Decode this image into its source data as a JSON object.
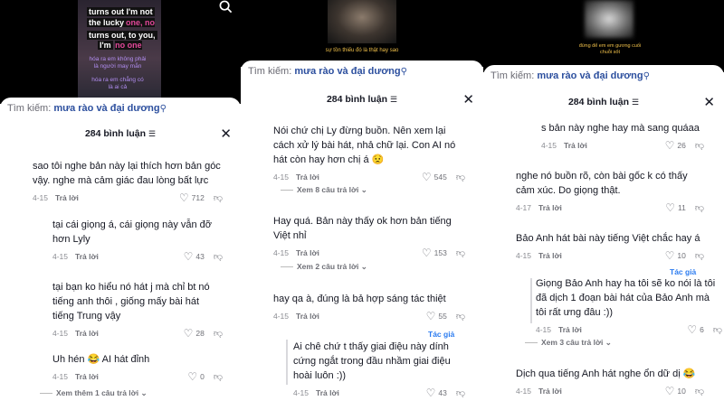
{
  "search": {
    "label": "Tìm kiếm:",
    "query": "mưa rào và đại dương",
    "icon": "search-icon"
  },
  "comments_title": "284 bình luận",
  "filter_icon": "filter-icon",
  "close_icon": "close-icon",
  "reply_label": "Trả lời",
  "panel1": {
    "video": {
      "line1": "turns out I'm not",
      "line2": "the lucky",
      "line2_hl": "one, no",
      "line3": "turns out, to you,",
      "line4": "I'm",
      "line4_hl": "no one",
      "sub1": "hóa ra em không phải",
      "sub2": "là người may mắn",
      "sub3": "hóa ra em chẳng có",
      "sub4": "là ai cả"
    },
    "comments": [
      {
        "text": "sao tôi nghe bản này lại thích hơn bản góc vậy. nghe mà cảm giác đau lòng bất lực",
        "date": "4-15",
        "likes": "712"
      },
      {
        "text": "tại cái giọng á, cái giọng này vẫn đỡ hơn Lyly",
        "date": "4-15",
        "likes": "43"
      },
      {
        "text": "tại bạn ko hiểu nó hát j mà chỉ bt nó tiếng anh thôi , giống mấy bài hát tiếng Trung vậy",
        "date": "4-15",
        "likes": "28"
      },
      {
        "text": "Uh hén 😂 AI hát đỉnh",
        "date": "4-15",
        "likes": "0"
      }
    ],
    "more": "Xem thêm 1 câu trả lời"
  },
  "panel2": {
    "video": {
      "sub": "sự tồn thiếu đó là thật hay sao"
    },
    "comments": [
      {
        "text": "Nói chứ chị Ly đừng buồn. Nên xem lại cách xử lý bài hát, nhả chữ lại. Con AI nó hát còn hay hơn chị á 😟",
        "date": "4-15",
        "likes": "545"
      },
      {
        "text": "Hay quá. Bản này thấy ok hơn bản tiếng Việt nhỉ",
        "date": "4-15",
        "likes": "153"
      },
      {
        "text": "hay qa à, đúng là bả hợp sáng tác thiệt",
        "date": "4-15",
        "likes": "55"
      },
      {
        "text": "Ai chê chứ t thấy giai điệu này dính cứng ngắt trong đầu nhầm giai điệu hoài luôn :))",
        "date": "4-15",
        "likes": "43"
      }
    ],
    "more1": "Xem 8 câu trả lời",
    "more2": "Xem 2 câu trả lời",
    "author": "Tác giả"
  },
  "panel3": {
    "video": {
      "sub1": "đừng để em em gương cuối",
      "sub2": "chuỗi sốt"
    },
    "comments": [
      {
        "text": "s bản này nghe hay mà sang quáaa",
        "date": "4-15",
        "likes": "26"
      },
      {
        "text": "nghe nó buồn rõ, còn bài gốc k có thấy cảm xúc. Do giọng thật.",
        "date": "4-17",
        "likes": "11"
      },
      {
        "text": "Bảo Anh hát bài này tiếng Việt chắc hay á",
        "date": "4-15",
        "likes": "10"
      },
      {
        "text": "Giọng Bảo Anh hay ha tôi sẽ ko nói là tôi đã dịch 1 đoạn bài hát của Bảo Anh mà tôi rất ưng đâu :))",
        "date": "4-15",
        "likes": "6"
      },
      {
        "text": "Dịch qua tiếng Anh hát nghe ổn dữ dị 😂",
        "date": "4-15",
        "likes": "10"
      }
    ],
    "more": "Xem 3 câu trả lời",
    "author": "Tác giả"
  }
}
